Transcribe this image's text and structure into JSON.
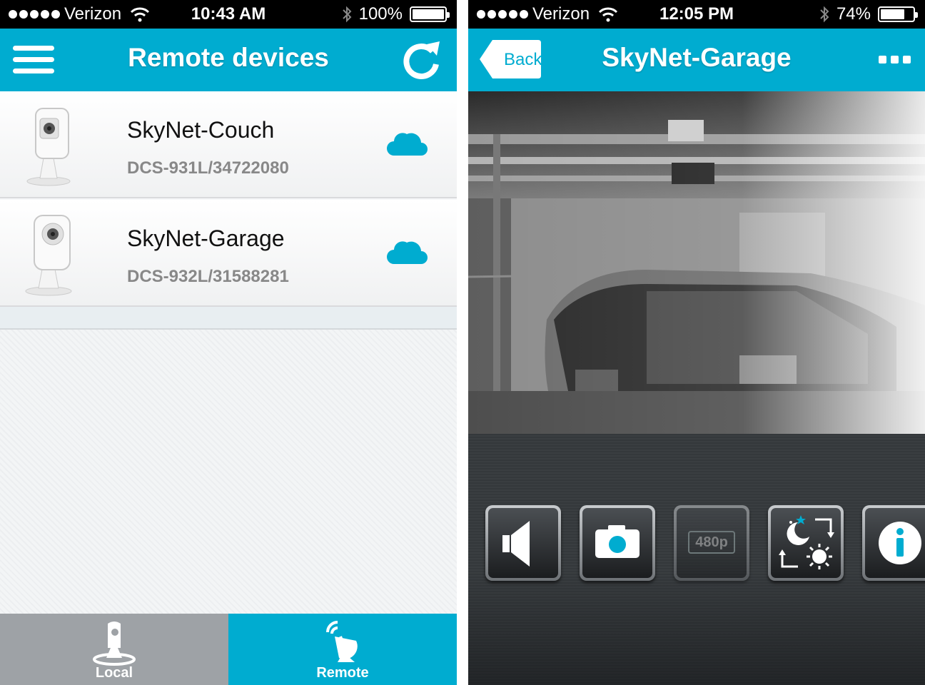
{
  "left": {
    "status_bar": {
      "carrier": "Verizon",
      "time": "10:43 AM",
      "battery": "100%",
      "battery_level": 1.0
    },
    "header": {
      "title": "Remote devices"
    },
    "devices": [
      {
        "name": "SkyNet-Couch",
        "model": "DCS-931L/34722080"
      },
      {
        "name": "SkyNet-Garage",
        "model": "DCS-932L/31588281"
      }
    ],
    "tabs": [
      {
        "label": "Local",
        "icon": "camera-local-icon",
        "active": false
      },
      {
        "label": "Remote",
        "icon": "satellite-dish-icon",
        "active": true
      }
    ]
  },
  "right": {
    "status_bar": {
      "carrier": "Verizon",
      "time": "12:05 PM",
      "battery": "74%",
      "battery_level": 0.74
    },
    "header": {
      "back_label": "Back",
      "title": "SkyNet-Garage"
    },
    "controls": {
      "buttons": [
        "speaker-icon",
        "snapshot-camera-icon",
        "resolution-icon",
        "day-night-icon",
        "info-icon"
      ],
      "resolution_label": "480p"
    }
  },
  "colors": {
    "accent": "#00acd0",
    "tab_inactive": "#9ea2a6",
    "status_bar": "#000000"
  }
}
